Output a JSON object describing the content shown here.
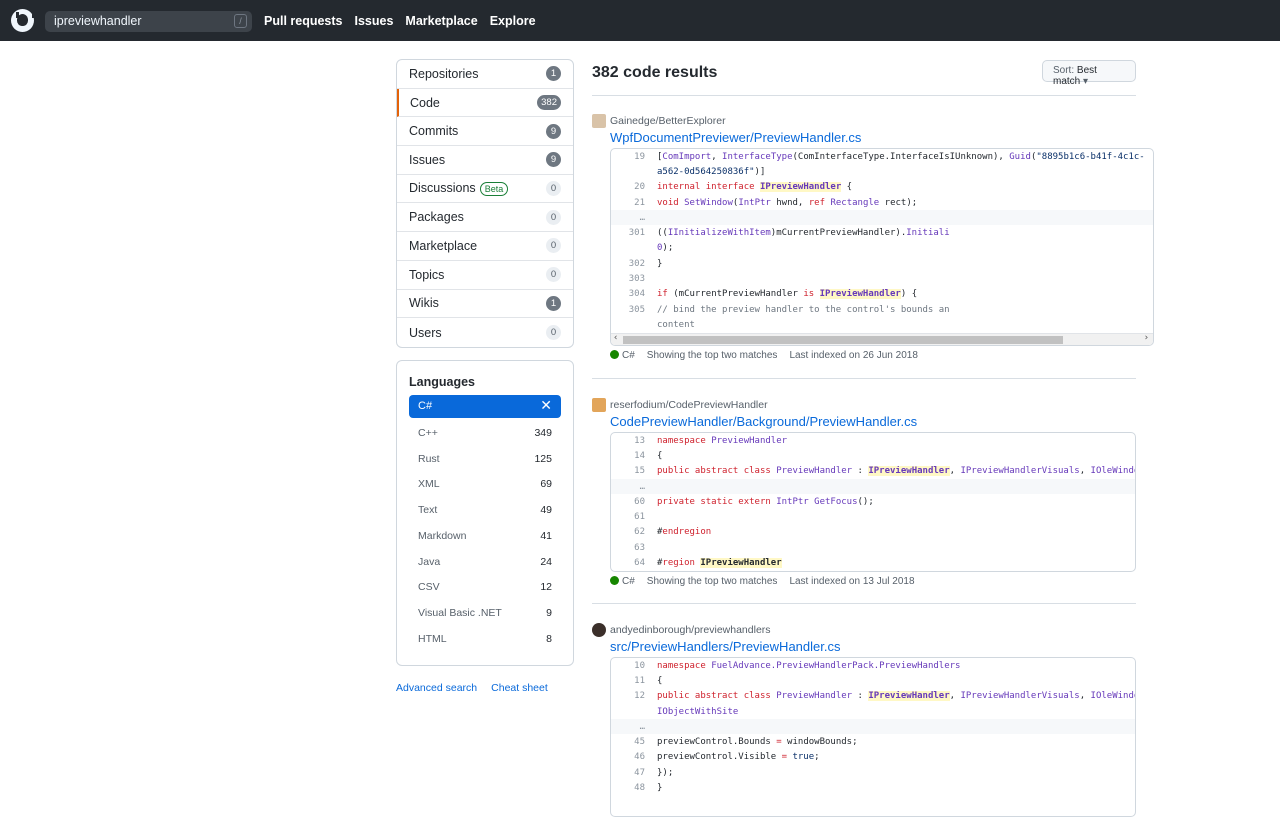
{
  "header": {
    "search_value": "ipreviewhandler",
    "slash_hint": "/",
    "nav": [
      "Pull requests",
      "Issues",
      "Marketplace",
      "Explore"
    ]
  },
  "menu": [
    {
      "label": "Repositories",
      "count": "1"
    },
    {
      "label": "Code",
      "count": "382"
    },
    {
      "label": "Commits",
      "count": "9"
    },
    {
      "label": "Issues",
      "count": "9"
    },
    {
      "label": "Discussions",
      "count": "0",
      "badge": "Beta"
    },
    {
      "label": "Packages",
      "count": "0"
    },
    {
      "label": "Marketplace",
      "count": "0"
    },
    {
      "label": "Topics",
      "count": "0"
    },
    {
      "label": "Wikis",
      "count": "1"
    },
    {
      "label": "Users",
      "count": "0"
    }
  ],
  "languages": {
    "title": "Languages",
    "selected": "C#",
    "items": [
      {
        "name": "C++",
        "count": "349"
      },
      {
        "name": "Rust",
        "count": "125"
      },
      {
        "name": "XML",
        "count": "69"
      },
      {
        "name": "Text",
        "count": "49"
      },
      {
        "name": "Markdown",
        "count": "41"
      },
      {
        "name": "Java",
        "count": "24"
      },
      {
        "name": "CSV",
        "count": "12"
      },
      {
        "name": "Visual Basic .NET",
        "count": "9"
      },
      {
        "name": "HTML",
        "count": "8"
      }
    ]
  },
  "links": {
    "advanced": "Advanced search",
    "cheat": "Cheat sheet"
  },
  "results_title": "382 code results",
  "sort": {
    "prefix": "Sort:",
    "value": "Best match"
  },
  "results": [
    {
      "repo": "Gainedge/BetterExplorer",
      "file": "WpfDocumentPreviewer/PreviewHandler.cs",
      "lang": "C#",
      "matches": "Showing the top two matches",
      "indexed": "Last indexed on 26 Jun 2018"
    },
    {
      "repo": "reserfodium/CodePreviewHandler",
      "file": "CodePreviewHandler/Background/PreviewHandler.cs",
      "lang": "C#",
      "matches": "Showing the top two matches",
      "indexed": "Last indexed on 13 Jul 2018"
    },
    {
      "repo": "andyedinborough/previewhandlers",
      "file": "src/PreviewHandlers/PreviewHandler.cs"
    }
  ],
  "colors": {
    "header": "#24292f",
    "link": "#0969da",
    "selected_lang": "#0969da",
    "csharp_dot": "#178600",
    "highlight": "#fff8c5"
  }
}
